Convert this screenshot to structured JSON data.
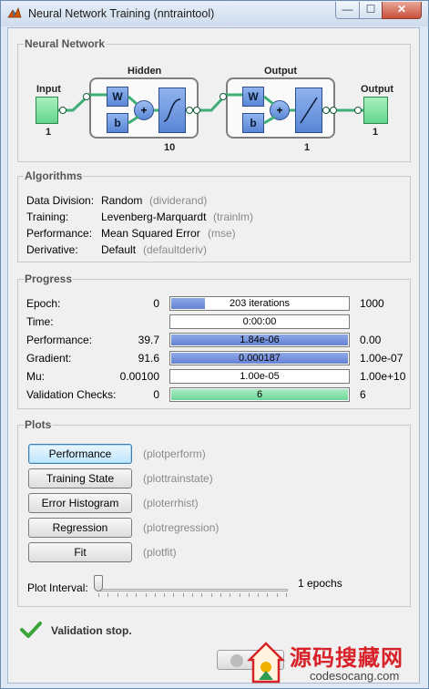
{
  "window": {
    "title": "Neural Network Training (nntraintool)",
    "min_glyph": "—",
    "max_glyph": "☐",
    "close_glyph": "✕"
  },
  "network": {
    "panel_title": "Neural Network",
    "input_label": "Input",
    "input_size": "1",
    "hidden_label": "Hidden",
    "hidden_size": "10",
    "output_layer_label": "Output",
    "output_layer_size": "1",
    "output_label": "Output",
    "output_size": "1",
    "weight_label": "W",
    "bias_label": "b",
    "sum_label": "+"
  },
  "algorithms": {
    "panel_title": "Algorithms",
    "rows": [
      {
        "label": "Data Division:",
        "value": "Random",
        "code": "(dividerand)"
      },
      {
        "label": "Training:",
        "value": "Levenberg-Marquardt",
        "code": "(trainlm)"
      },
      {
        "label": "Performance:",
        "value": "Mean Squared Error",
        "code": "(mse)"
      },
      {
        "label": "Derivative:",
        "value": "Default",
        "code": "(defaultderiv)"
      }
    ]
  },
  "progress": {
    "panel_title": "Progress",
    "rows": [
      {
        "label": "Epoch:",
        "start": "0",
        "text": "203 iterations",
        "end": "1000",
        "fill": 0.2,
        "style": "blue"
      },
      {
        "label": "Time:",
        "start": "",
        "text": "0:00:00",
        "end": "",
        "fill": 0,
        "style": "blue"
      },
      {
        "label": "Performance:",
        "start": "39.7",
        "text": "1.84e-06",
        "end": "0.00",
        "fill": 1.0,
        "style": "blue"
      },
      {
        "label": "Gradient:",
        "start": "91.6",
        "text": "0.000187",
        "end": "1.00e-07",
        "fill": 1.0,
        "style": "blue"
      },
      {
        "label": "Mu:",
        "start": "0.00100",
        "text": "1.00e-05",
        "end": "1.00e+10",
        "fill": 0,
        "style": "blue"
      },
      {
        "label": "Validation Checks:",
        "start": "0",
        "text": "6",
        "end": "6",
        "fill": 1.0,
        "style": "green"
      }
    ]
  },
  "plots": {
    "panel_title": "Plots",
    "buttons": [
      {
        "label": "Performance",
        "code": "(plotperform)"
      },
      {
        "label": "Training State",
        "code": "(plottrainstate)"
      },
      {
        "label": "Error Histogram",
        "code": "(ploterrhist)"
      },
      {
        "label": "Regression",
        "code": "(plotregression)"
      },
      {
        "label": "Fit",
        "code": "(plotfit)"
      }
    ],
    "interval_label": "Plot Interval:",
    "interval_value": "1 epochs"
  },
  "status": {
    "message": "Validation stop."
  },
  "watermark": {
    "cn_text": "源码搜藏网",
    "domain": "codesocang.com"
  },
  "colors": {
    "accent_blue": "#6582d4",
    "validation_green": "#6fd69a",
    "check_green": "#39a639",
    "watermark_red": "#d8222a"
  }
}
